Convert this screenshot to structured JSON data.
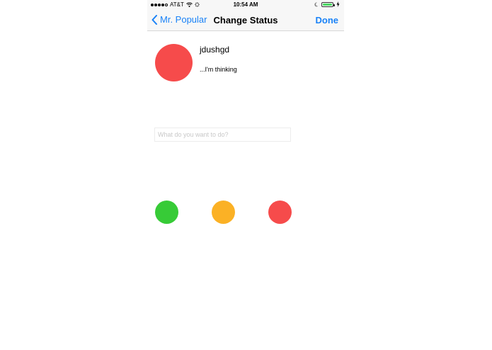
{
  "status_bar": {
    "carrier": "AT&T",
    "time": "10:54 AM",
    "icons": [
      "signal-dots-icon",
      "wifi-icon",
      "activity-spinner-icon",
      "moon-icon",
      "battery-icon",
      "charging-bolt-icon"
    ]
  },
  "nav": {
    "back_label": "Mr. Popular",
    "title": "Change Status",
    "done_label": "Done"
  },
  "profile": {
    "username": "jdushgd",
    "status_text": "...I'm thinking",
    "avatar_color": "#f64b4b"
  },
  "activity": {
    "placeholder": "What do you want to do?",
    "value": ""
  },
  "status_options": [
    {
      "name": "green",
      "color": "#37cb37"
    },
    {
      "name": "orange",
      "color": "#fbb125"
    },
    {
      "name": "red",
      "color": "#f64b4b"
    }
  ],
  "colors": {
    "accent": "#1a82f7",
    "battery": "#4cd964"
  }
}
